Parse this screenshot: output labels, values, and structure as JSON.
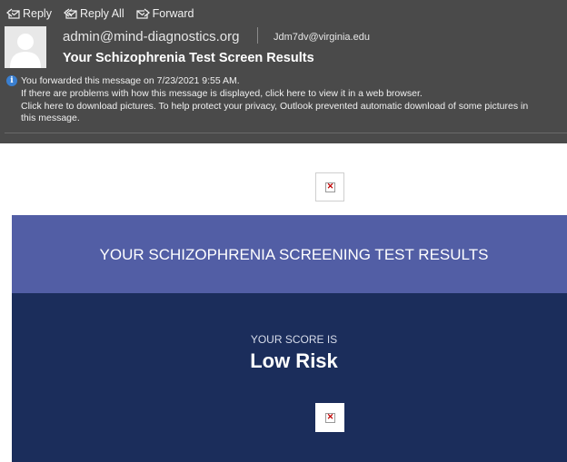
{
  "toolbar": {
    "reply": "Reply",
    "reply_all": "Reply All",
    "forward": "Forward"
  },
  "message": {
    "from": "admin@mind-diagnostics.org",
    "to": "Jdm7dv@virginia.edu",
    "subject": "Your Schizophrenia Test Screen Results"
  },
  "info": {
    "forwarded": "You forwarded this message on 7/23/2021 9:55 AM.",
    "display_problem": "If there are problems with how this message is displayed, click here to view it in a web browser.",
    "download_pictures": "Click here to download pictures. To help protect your privacy, Outlook prevented automatic download of some pictures in",
    "download_pictures_cont": "this message."
  },
  "email_body": {
    "banner_title": "YOUR SCHIZOPHRENIA SCREENING TEST RESULTS",
    "score_label": "YOUR SCORE IS",
    "score_value": "Low Risk"
  },
  "colors": {
    "header_bg": "#4a4a4a",
    "banner_bg": "#525ea5",
    "score_bg": "#1b2d5b"
  }
}
